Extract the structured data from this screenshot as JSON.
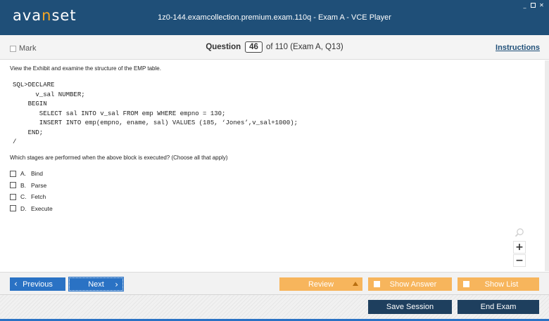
{
  "app": {
    "logo_left": "ava",
    "logo_accent": "n",
    "logo_right": "set",
    "title": "1z0-144.examcollection.premium.exam.110q - Exam A - VCE Player"
  },
  "header": {
    "mark_label": "Mark",
    "question_label": "Question",
    "question_number": "46",
    "question_total": "of 110 (Exam A, Q13)",
    "instructions_label": "Instructions"
  },
  "question": {
    "stem": "View the Exhibit and examine the structure of the EMP table.",
    "code": "SQL>DECLARE\n      v_sal NUMBER;\n    BEGIN\n       SELECT sal INTO v_sal FROM emp WHERE empno = 130;\n       INSERT INTO emp(empno, ename, sal) VALUES (185, ‘Jones’,v_sal+1000);\n    END;\n/",
    "prompt": "Which stages are performed when the above block is executed? (Choose all that apply)",
    "options": [
      {
        "letter": "A.",
        "text": "Bind"
      },
      {
        "letter": "B.",
        "text": "Parse"
      },
      {
        "letter": "C.",
        "text": "Fetch"
      },
      {
        "letter": "D.",
        "text": "Execute"
      }
    ]
  },
  "zoom": {
    "in": "+",
    "out": "−"
  },
  "nav": {
    "previous": "Previous",
    "next": "Next",
    "review": "Review",
    "show_answer": "Show Answer",
    "show_list": "Show List"
  },
  "footer": {
    "save_session": "Save Session",
    "end_exam": "End Exam"
  },
  "colors": {
    "titlebar": "#1f4f78",
    "logo_accent": "#f5a623",
    "nav_blue": "#2a72c4",
    "nav_orange": "#f7b55c",
    "footer_dark": "#1e3f5e"
  },
  "icons": {
    "window_minimize": "minimize-icon",
    "window_maximize": "maximize-icon",
    "window_close": "close-icon",
    "zoom": "magnifier-icon",
    "prev_chevron": "chevron-left-icon",
    "next_chevron": "chevron-right-icon",
    "review_arrow": "caret-up-icon"
  }
}
